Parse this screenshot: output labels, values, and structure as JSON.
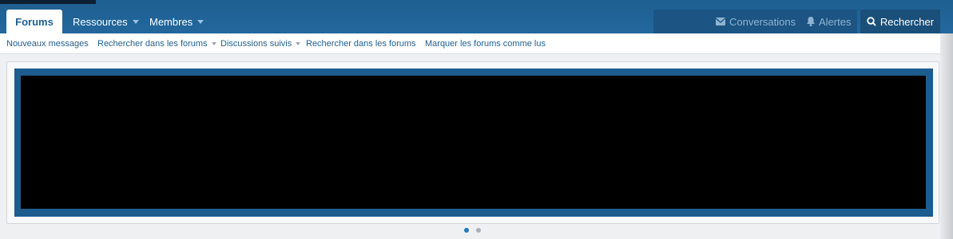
{
  "nav": {
    "tabs": [
      {
        "label": "Forums",
        "active": true
      },
      {
        "label": "Ressources",
        "has_dropdown": true
      },
      {
        "label": "Membres",
        "has_dropdown": true
      }
    ],
    "right": {
      "conversations": "Conversations",
      "alerts": "Alertes",
      "search": "Rechercher"
    }
  },
  "subnav": {
    "links": [
      {
        "label": "Nouveaux messages"
      },
      {
        "label": "Rechercher dans les forums",
        "has_dropdown": true
      },
      {
        "label": "Discussions suivis",
        "has_dropdown": true
      },
      {
        "label": "Rechercher dans les forums"
      },
      {
        "label": "Marquer les forums comme lus"
      }
    ]
  },
  "carousel": {
    "slide_count": 2,
    "active_index": 0,
    "colors": {
      "active_dot": "#2577b5",
      "inactive_dot": "#a9b0b7",
      "frame": "#1d5c8e"
    }
  },
  "icons": {
    "conversations": "envelope-icon",
    "alerts": "bell-icon",
    "search": "search-icon"
  },
  "colors": {
    "header": "#1f5f91",
    "link": "#1f5f91"
  }
}
